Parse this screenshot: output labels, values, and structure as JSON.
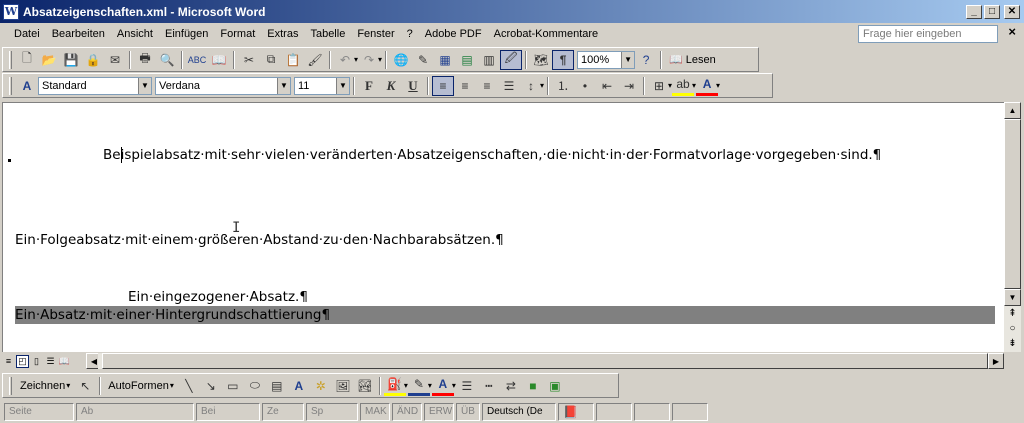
{
  "window": {
    "title": "Absatzeigenschaften.xml - Microsoft Word"
  },
  "menu": {
    "items": [
      "Datei",
      "Bearbeiten",
      "Ansicht",
      "Einfügen",
      "Format",
      "Extras",
      "Tabelle",
      "Fenster",
      "?",
      "Adobe PDF",
      "Acrobat-Kommentare"
    ],
    "help_placeholder": "Frage hier eingeben"
  },
  "standard_toolbar": {
    "zoom": "100%",
    "read_label": "Lesen"
  },
  "format_toolbar": {
    "style": "Standard",
    "font": "Verdana",
    "size": "11"
  },
  "document": {
    "paragraphs": [
      "Beispielabsatz·mit·sehr·vielen·veränderten·Absatzeigenschaften,·die·nicht·in·der·Formatvorlage·vorgegeben·sind.¶",
      "Ein·Folgeabsatz·mit·einem·größeren·Abstand·zu·den·Nachbarabsätzen.¶",
      "Ein·eingezogener·Absatz.¶",
      "Ein·Absatz·mit·einer·Hintergrundschattierung¶"
    ]
  },
  "drawing_toolbar": {
    "draw_label": "Zeichnen",
    "autoshapes_label": "AutoFormen"
  },
  "statusbar": {
    "page": "Seite",
    "section": "Ab",
    "at": "Bei",
    "line": "Ze",
    "column": "Sp",
    "rec": "MAK",
    "trk": "ÄND",
    "ext": "ERW",
    "ovr": "ÜB",
    "language": "Deutsch (De"
  },
  "colors": {
    "title_start": "#0a246a",
    "title_end": "#a6caf0",
    "shading": "#808080",
    "highlight": "#ffff00",
    "font_color": "#ff0000"
  }
}
